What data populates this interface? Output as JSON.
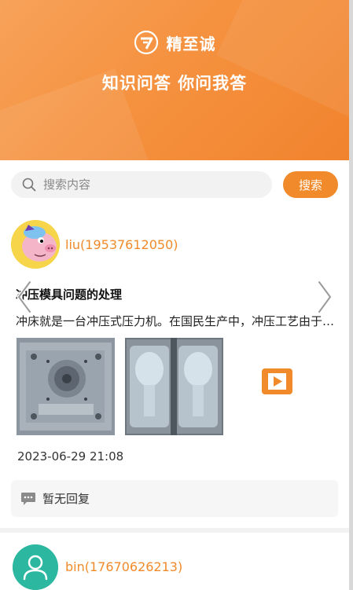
{
  "header": {
    "brand": "精至诚",
    "slogan": "知识问答 你问我答",
    "colors": {
      "gradient_start": "#f7a25a",
      "gradient_end": "#f1832d"
    }
  },
  "search": {
    "placeholder": "搜索内容",
    "button_label": "搜索"
  },
  "posts": [
    {
      "username": "liu(19537612050)",
      "title": "冲压模具问题的处理",
      "excerpt": "冲床就是一台冲压式压力机。在国民生产中，冲压工艺由于比传统机械加工来说有节约材料和能源，效率高",
      "time": "2023-06-29 21:08",
      "reply_status": "暂无回复"
    },
    {
      "username": "bin(17670626213)"
    }
  ],
  "accent_color": "#f08a2a"
}
